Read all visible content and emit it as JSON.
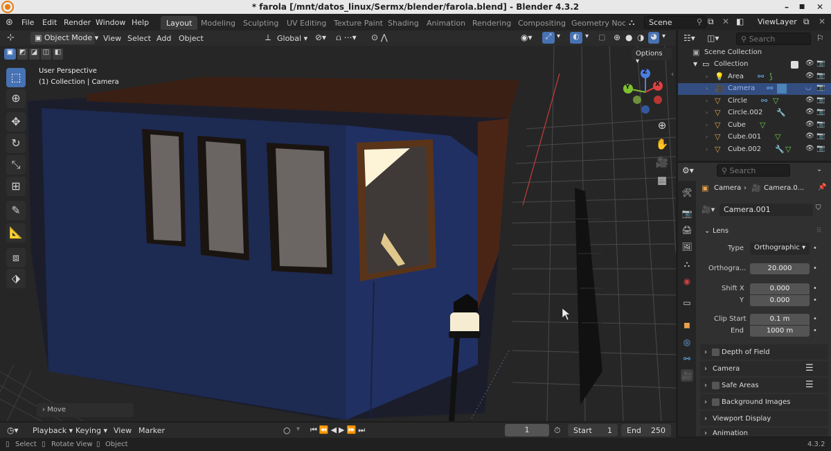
{
  "window": {
    "title": "* farola [/mnt/datos_linux/Sermx/blender/farola.blend] - Blender 4.3.2",
    "minimize": "–",
    "maximize": "■",
    "close": "✕"
  },
  "menu": [
    "File",
    "Edit",
    "Render",
    "Window",
    "Help"
  ],
  "workspaces": [
    "Layout",
    "Modeling",
    "Sculpting",
    "UV Editing",
    "Texture Paint",
    "Shading",
    "Animation",
    "Rendering",
    "Compositing",
    "Geometry Node"
  ],
  "scene": {
    "name": "Scene",
    "viewlayer": "ViewLayer"
  },
  "viewport_header": {
    "mode": "Object Mode",
    "items": [
      "View",
      "Select",
      "Add",
      "Object"
    ],
    "orientation": "Global",
    "options": "Options"
  },
  "viewport": {
    "view_name": "User Perspective",
    "context": "(1) Collection | Camera",
    "last_op": "Move"
  },
  "gizmo": {
    "z": "Z",
    "y": "Y",
    "x": "X"
  },
  "outliner": {
    "search_placeholder": "Search",
    "rows": [
      "Scene Collection",
      "Collection",
      "Area",
      "Camera",
      "Circle",
      "Circle.002",
      "Cube",
      "Cube.001",
      "Cube.002"
    ]
  },
  "properties": {
    "search_placeholder": "Search",
    "breadcrumb_obj": "Camera",
    "breadcrumb_data": "Camera.0...",
    "datablock": "Camera.001",
    "lens": {
      "title": "Lens",
      "type_label": "Type",
      "type_value": "Orthographic",
      "ortho_label": "Orthogra...",
      "ortho_value": "20.000",
      "shiftx_label": "Shift X",
      "shiftx_value": "0.000",
      "shifty_label": "Y",
      "shifty_value": "0.000",
      "clipstart_label": "Clip Start",
      "clipstart_value": "0.1 m",
      "clipend_label": "End",
      "clipend_value": "1000 m"
    },
    "sections": [
      "Depth of Field",
      "Camera",
      "Safe Areas",
      "Background Images",
      "Viewport Display",
      "Animation"
    ]
  },
  "timeline": {
    "items": [
      "Playback",
      "Keying",
      "View",
      "Marker"
    ],
    "frame": "1",
    "start_label": "Start",
    "start": "1",
    "end_label": "End",
    "end": "250"
  },
  "status": {
    "select": "Select",
    "rotate": "Rotate View",
    "object": "Object",
    "version": "4.3.2"
  },
  "colors": {
    "accent": "#4772b3",
    "selection": "#334d80",
    "orange": "#e87d0d"
  }
}
